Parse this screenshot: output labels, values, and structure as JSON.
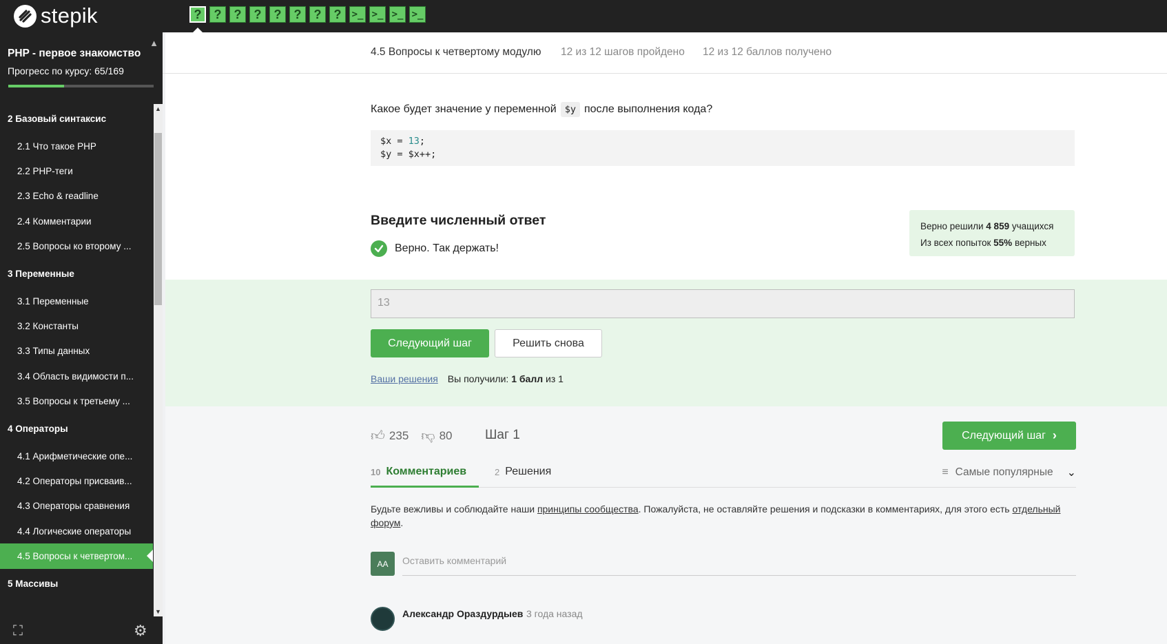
{
  "app": {
    "logo_text": "stepik"
  },
  "steps": [
    {
      "type": "question",
      "label": "?"
    },
    {
      "type": "question",
      "label": "?"
    },
    {
      "type": "question",
      "label": "?"
    },
    {
      "type": "question",
      "label": "?"
    },
    {
      "type": "question",
      "label": "?"
    },
    {
      "type": "question",
      "label": "?"
    },
    {
      "type": "question",
      "label": "?"
    },
    {
      "type": "question",
      "label": "?"
    },
    {
      "type": "code",
      "label": ">_"
    },
    {
      "type": "code",
      "label": ">_"
    },
    {
      "type": "code",
      "label": ">_"
    },
    {
      "type": "code",
      "label": ">_"
    }
  ],
  "sidebar": {
    "course_title": "PHP - первое знакомство",
    "progress_text": "Прогресс по курсу:  65/169",
    "progress_fraction": 0.385,
    "sections": [
      {
        "title": "2  Базовый синтаксис",
        "lessons": [
          "2.1  Что такое PHP",
          "2.2  PHP-теги",
          "2.3  Echo & readline",
          "2.4  Комментарии",
          "2.5  Вопросы ко второму ..."
        ]
      },
      {
        "title": "3  Переменные",
        "lessons": [
          "3.1  Переменные",
          "3.2  Константы",
          "3.3  Типы данных",
          "3.4  Область видимости п...",
          "3.5  Вопросы к третьему ..."
        ]
      },
      {
        "title": "4  Операторы",
        "lessons": [
          "4.1  Арифметические опе...",
          "4.2  Операторы присваив...",
          "4.3  Операторы сравнения",
          "4.4  Логические операторы",
          "4.5  Вопросы к четвертом..."
        ]
      },
      {
        "title": "5  Массивы",
        "lessons": []
      }
    ]
  },
  "header": {
    "lesson_title": "4.5 Вопросы к четвертому модулю",
    "steps_passed": "12 из 12 шагов пройдено",
    "score": "12 из 12 баллов  получено"
  },
  "question": {
    "before": "Какое будет значение у переменной",
    "var": "$y",
    "after": "после выполнения кода?",
    "code_line1_a": "$x = ",
    "code_line1_num": "13",
    "code_line1_b": ";",
    "code_line2": "$y = $x++;"
  },
  "answer": {
    "title": "Введите численный ответ",
    "result_text": "Верно. Так держать!",
    "stats_line1_a": "Верно решили ",
    "stats_line1_b": "4 859",
    "stats_line1_c": " учащихся",
    "stats_line2_a": "Из всех попыток ",
    "stats_line2_b": "55%",
    "stats_line2_c": " верных",
    "input_value": "13",
    "next_button": "Следующий шаг",
    "again_button": "Решить снова",
    "your_solutions": "Ваши решения",
    "got_a": "Вы получили: ",
    "got_b": "1 балл",
    "got_c": " из 1"
  },
  "footer": {
    "likes": "235",
    "dislikes": "80",
    "step_label": "Шаг 1",
    "next_button": "Следующий шаг",
    "tabs": [
      {
        "count": "10",
        "label": "Комментариев"
      },
      {
        "count": "2",
        "label": "Решения"
      }
    ],
    "sort_label": "Самые популярные",
    "rules_a": "Будьте вежливы и соблюдайте наши ",
    "rules_link1": "принципы сообщества",
    "rules_b": ". Пожалуйста, не оставляйте решения и подсказки в комментариях, для этого есть ",
    "rules_link2": "отдельный форум",
    "rules_c": ".",
    "avatar_initials": "AA",
    "comment_placeholder": "Оставить комментарий",
    "comment_author": "Александр Ораздурдыев",
    "comment_time": "3 года назад"
  },
  "colors": {
    "accent": "#4caf50",
    "topbar": "#222222",
    "success_bg": "#e8f6e9"
  }
}
